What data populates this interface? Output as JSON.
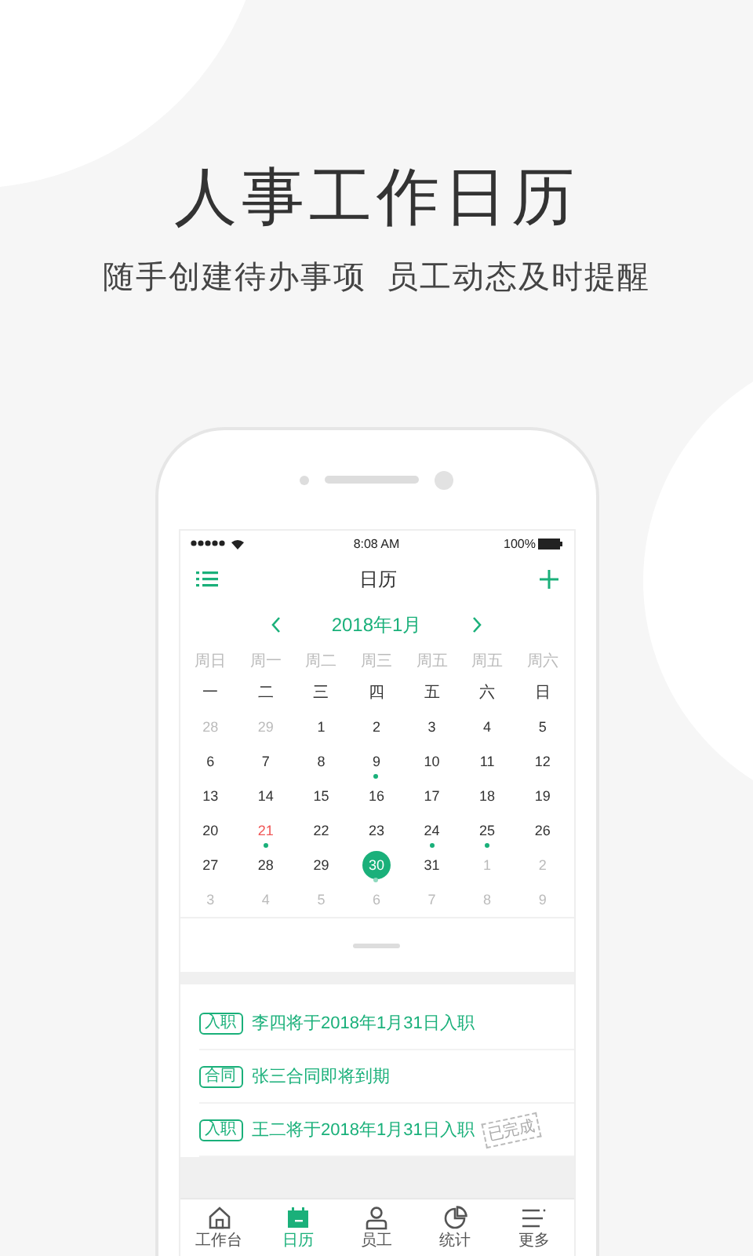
{
  "headline": "人事工作日历",
  "tagline": "随手创建待办事项  员工动态及时提醒",
  "status_bar": {
    "time": "8:08 AM",
    "battery": "100%"
  },
  "header": {
    "title": "日历"
  },
  "month": "2018年1月",
  "weekdays": [
    "周日",
    "周一",
    "周二",
    "周三",
    "周五",
    "周五",
    "周六"
  ],
  "numerals": [
    "一",
    "二",
    "三",
    "四",
    "五",
    "六",
    "日"
  ],
  "weeks": [
    [
      {
        "label": "28",
        "kind": "other",
        "dot": false,
        "selected": false
      },
      {
        "label": "29",
        "kind": "other",
        "dot": false,
        "selected": false
      },
      {
        "label": "1",
        "kind": "current",
        "dot": false,
        "selected": false
      },
      {
        "label": "2",
        "kind": "current",
        "dot": false,
        "selected": false
      },
      {
        "label": "3",
        "kind": "current",
        "dot": false,
        "selected": false
      },
      {
        "label": "4",
        "kind": "current",
        "dot": false,
        "selected": false
      },
      {
        "label": "5",
        "kind": "current",
        "dot": false,
        "selected": false
      }
    ],
    [
      {
        "label": "6",
        "kind": "current",
        "dot": false,
        "selected": false
      },
      {
        "label": "7",
        "kind": "current",
        "dot": false,
        "selected": false
      },
      {
        "label": "8",
        "kind": "current",
        "dot": false,
        "selected": false
      },
      {
        "label": "9",
        "kind": "current",
        "dot": true,
        "selected": false
      },
      {
        "label": "10",
        "kind": "current",
        "dot": false,
        "selected": false
      },
      {
        "label": "11",
        "kind": "current",
        "dot": false,
        "selected": false
      },
      {
        "label": "12",
        "kind": "current",
        "dot": false,
        "selected": false
      }
    ],
    [
      {
        "label": "13",
        "kind": "current",
        "dot": false,
        "selected": false
      },
      {
        "label": "14",
        "kind": "current",
        "dot": false,
        "selected": false
      },
      {
        "label": "15",
        "kind": "current",
        "dot": false,
        "selected": false
      },
      {
        "label": "16",
        "kind": "current",
        "dot": false,
        "selected": false
      },
      {
        "label": "17",
        "kind": "current",
        "dot": false,
        "selected": false
      },
      {
        "label": "18",
        "kind": "current",
        "dot": false,
        "selected": false
      },
      {
        "label": "19",
        "kind": "current",
        "dot": false,
        "selected": false
      }
    ],
    [
      {
        "label": "20",
        "kind": "current",
        "dot": false,
        "selected": false
      },
      {
        "label": "21",
        "kind": "holiday",
        "dot": true,
        "selected": false
      },
      {
        "label": "22",
        "kind": "current",
        "dot": false,
        "selected": false
      },
      {
        "label": "23",
        "kind": "current",
        "dot": false,
        "selected": false
      },
      {
        "label": "24",
        "kind": "current",
        "dot": true,
        "selected": false
      },
      {
        "label": "25",
        "kind": "current",
        "dot": true,
        "selected": false
      },
      {
        "label": "26",
        "kind": "current",
        "dot": false,
        "selected": false
      }
    ],
    [
      {
        "label": "27",
        "kind": "current",
        "dot": false,
        "selected": false
      },
      {
        "label": "28",
        "kind": "current",
        "dot": false,
        "selected": false
      },
      {
        "label": "29",
        "kind": "current",
        "dot": false,
        "selected": false
      },
      {
        "label": "30",
        "kind": "current",
        "dot": true,
        "selected": true
      },
      {
        "label": "31",
        "kind": "current",
        "dot": false,
        "selected": false
      },
      {
        "label": "1",
        "kind": "other",
        "dot": false,
        "selected": false
      },
      {
        "label": "2",
        "kind": "other",
        "dot": false,
        "selected": false
      }
    ],
    [
      {
        "label": "3",
        "kind": "other",
        "dot": false,
        "selected": false
      },
      {
        "label": "4",
        "kind": "other",
        "dot": false,
        "selected": false
      },
      {
        "label": "5",
        "kind": "other",
        "dot": false,
        "selected": false
      },
      {
        "label": "6",
        "kind": "other",
        "dot": false,
        "selected": false
      },
      {
        "label": "7",
        "kind": "other",
        "dot": false,
        "selected": false
      },
      {
        "label": "8",
        "kind": "other",
        "dot": false,
        "selected": false
      },
      {
        "label": "9",
        "kind": "other",
        "dot": false,
        "selected": false
      }
    ]
  ],
  "events": [
    {
      "tag": "入职",
      "text": "李四将于2018年1月31日入职"
    },
    {
      "tag": "合同",
      "text": "张三合同即将到期"
    },
    {
      "tag": "入职",
      "text": "王二将于2018年1月31日入职",
      "stamp": "已完成"
    }
  ],
  "tabs": [
    {
      "label": "工作台",
      "selected": false
    },
    {
      "label": "日历",
      "selected": true
    },
    {
      "label": "员工",
      "selected": false
    },
    {
      "label": "统计",
      "selected": false
    },
    {
      "label": "更多",
      "selected": false
    }
  ]
}
